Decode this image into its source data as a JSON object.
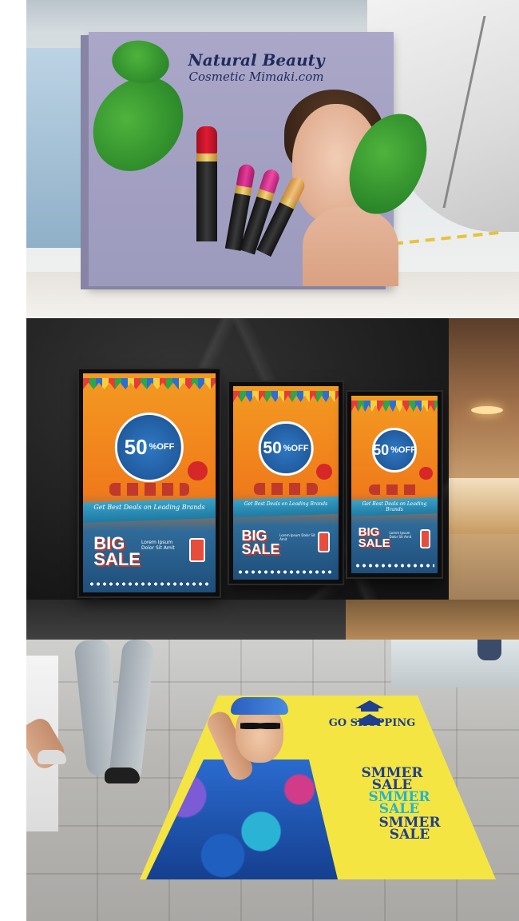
{
  "billboard": {
    "title": "Natural Beauty",
    "subtitle": "Cosmetic Mimaki.com"
  },
  "posters": {
    "discount": "50",
    "discount_suffix": "%OFF",
    "tagline": "Get Best Deals on Leading Brands",
    "big_sale_line1": "BIG",
    "big_sale_line2": "SALE",
    "lorem": "Lorem Ipsum Dolor Sit Amit"
  },
  "floor_sticker": {
    "cta": "GO SHOPPING",
    "sale_lines": [
      {
        "word": "SMMER",
        "sale": "SALE"
      },
      {
        "word": "SMMER",
        "sale": "SALE"
      },
      {
        "word": "SMMER",
        "sale": "SALE"
      }
    ]
  },
  "colors": {
    "billboard_bg": "#9c9abd",
    "billboard_text": "#1d2a5c",
    "poster_orange": "#f07a1a",
    "poster_blue": "#1f4e7a",
    "sticker_yellow": "#f4e542",
    "sticker_navy": "#1f3f8f",
    "sticker_cyan": "#1fb5d0"
  }
}
